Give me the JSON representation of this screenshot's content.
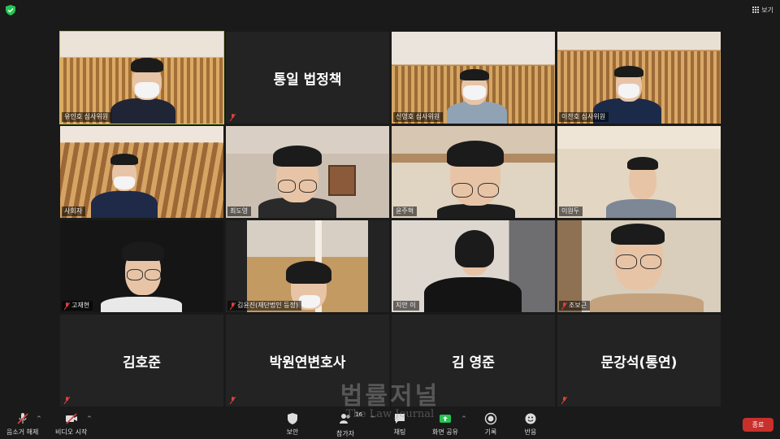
{
  "top": {
    "view_label": "보기"
  },
  "tiles": {
    "t1": {
      "name": "유인호 심사위원"
    },
    "t2": {
      "display_name": "통일 법정책"
    },
    "t3": {
      "name": "신영호 심사위원"
    },
    "t4": {
      "name": "이찬호 심사위원"
    },
    "t5": {
      "name": "사회자"
    },
    "t6": {
      "name": "최도영"
    },
    "t7": {
      "name": "윤주혁"
    },
    "t8": {
      "name": "이원두"
    },
    "t9": {
      "name": "고재현"
    },
    "t10": {
      "name": "김윤진(재단법인 등정)"
    },
    "t11": {
      "name": "지안 이"
    },
    "t12": {
      "name": "조보근"
    },
    "t13": {
      "display_name": "김호준"
    },
    "t14": {
      "display_name": "박원연변호사"
    },
    "t15": {
      "display_name": "김 영준"
    },
    "t16": {
      "display_name": "문강석(통연)"
    }
  },
  "watermark": {
    "korean": "법률저널",
    "english": "The Law Journal"
  },
  "toolbar": {
    "mute_label": "음소거 해제",
    "video_label": "비디오 시작",
    "security_label": "보안",
    "participants_label": "참가자",
    "participants_count": "16",
    "chat_label": "채팅",
    "share_label": "화면 공유",
    "record_label": "기록",
    "reactions_label": "반응",
    "end_label": "종료"
  },
  "colors": {
    "active_speaker": "#b9d13a",
    "end_button": "#c8302c",
    "share_green": "#23c552",
    "mic_off_red": "#e0413a"
  }
}
